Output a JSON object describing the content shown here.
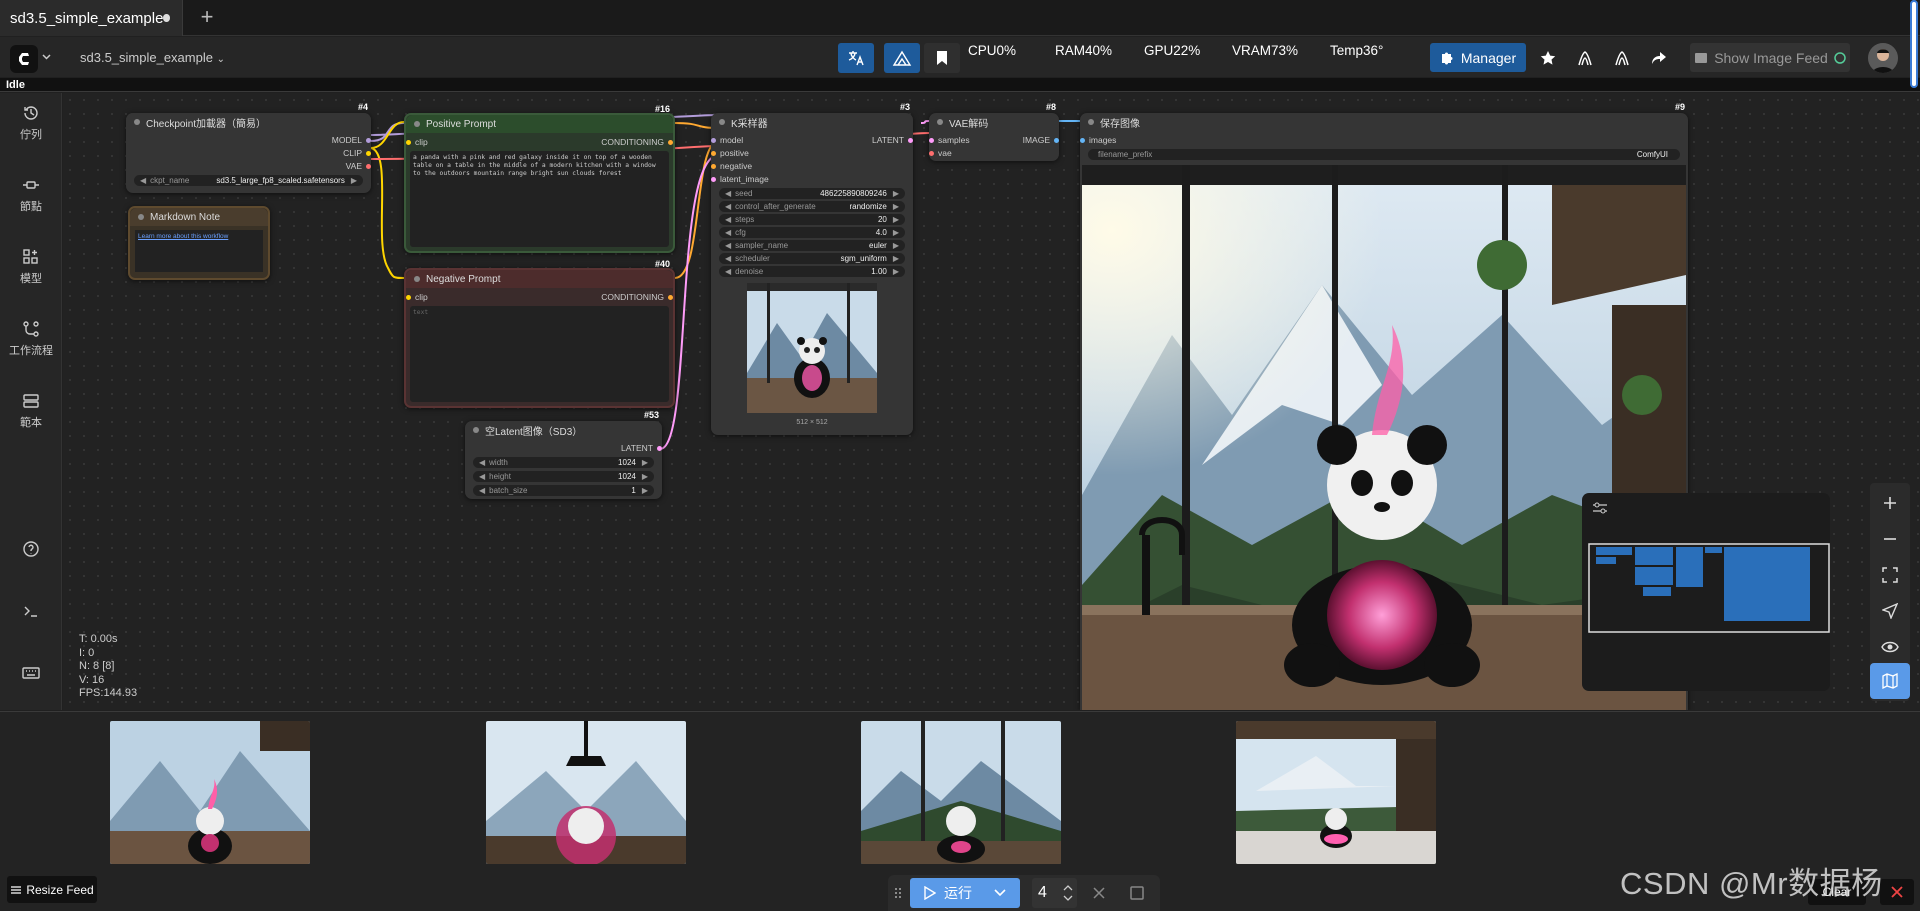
{
  "tabs": [
    {
      "label": "sd3.5_simple_example"
    }
  ],
  "topbar": {
    "workflow_name": "sd3.5_simple_example",
    "stats": {
      "cpu": "CPU0%",
      "ram": "RAM40%",
      "gpu": "GPU22%",
      "vram": "VRAM73%",
      "temp": "Temp36°"
    },
    "manager_label": "Manager",
    "feed_label": "Show Image Feed"
  },
  "status": "Idle",
  "sidebar": {
    "items": [
      {
        "label": "佇列",
        "icon": "history-icon"
      },
      {
        "label": "節點",
        "icon": "node-icon"
      },
      {
        "label": "模型",
        "icon": "model-icon"
      },
      {
        "label": "工作流程",
        "icon": "workflow-icon"
      },
      {
        "label": "範本",
        "icon": "template-icon"
      }
    ]
  },
  "nodes": {
    "checkpoint": {
      "id": "#4",
      "title": "Checkpoint加載器（簡易）",
      "outputs": [
        "MODEL",
        "CLIP",
        "VAE"
      ],
      "widget_name": "ckpt_name",
      "widget_value": "sd3.5_large_fp8_scaled.safetensors"
    },
    "markdown": {
      "title": "Markdown Note",
      "link": "Learn more about this workflow"
    },
    "positive": {
      "id": "#16",
      "title": "Positive Prompt",
      "input": "clip",
      "output": "CONDITIONING",
      "text": "a panda with a pink and red galaxy inside it on top of a wooden table on a table in the middle of a modern kitchen with a window to the outdoors mountain range bright sun clouds forest"
    },
    "negative": {
      "id": "#40",
      "title": "Negative Prompt",
      "input": "clip",
      "output": "CONDITIONING",
      "placeholder": "text"
    },
    "latent": {
      "id": "#53",
      "title": "空Latent图像（SD3）",
      "output": "LATENT",
      "widgets": [
        {
          "name": "width",
          "value": "1024"
        },
        {
          "name": "height",
          "value": "1024"
        },
        {
          "name": "batch_size",
          "value": "1"
        }
      ]
    },
    "ksampler": {
      "id": "#3",
      "title": "K采样器",
      "inputs": [
        "model",
        "positive",
        "negative",
        "latent_image"
      ],
      "output": "LATENT",
      "widgets": [
        {
          "name": "seed",
          "value": "486225890809246"
        },
        {
          "name": "control_after_generate",
          "value": "randomize"
        },
        {
          "name": "steps",
          "value": "20"
        },
        {
          "name": "cfg",
          "value": "4.0"
        },
        {
          "name": "sampler_name",
          "value": "euler"
        },
        {
          "name": "scheduler",
          "value": "sgm_uniform"
        },
        {
          "name": "denoise",
          "value": "1.00"
        }
      ],
      "preview_size": "512 × 512"
    },
    "vae": {
      "id": "#8",
      "title": "VAE解码",
      "inputs": [
        "samples",
        "vae"
      ],
      "output": "IMAGE"
    },
    "save": {
      "id": "#9",
      "title": "保存图像",
      "input": "images",
      "widget_name": "filename_prefix",
      "widget_value": "ComfyUI"
    }
  },
  "canvas_stats": {
    "t": "T: 0.00s",
    "i": "I: 0",
    "n": "N: 8 [8]",
    "v": "V: 16",
    "fps": "FPS:144.93"
  },
  "bottom": {
    "resize_label": "Resize Feed",
    "run_label": "运行",
    "run_count": "4",
    "clear_label": "Clear",
    "watermark": "CSDN @Mr数据杨"
  },
  "colors": {
    "accent": "#1e5b9b",
    "run": "#5a9ae8",
    "clip": "#ffd500",
    "model": "#b39ddb",
    "vae": "#ff6e6e",
    "latent": "#ff9cf9",
    "cond": "#ffa931",
    "image": "#64b5f6"
  }
}
